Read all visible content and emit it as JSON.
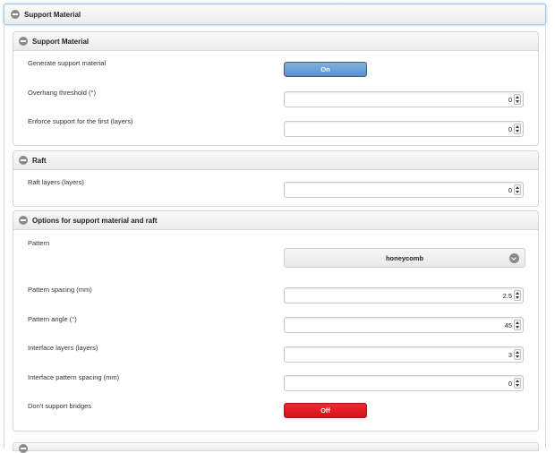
{
  "outer": {
    "title": "Support Material"
  },
  "support_panel": {
    "title": "Support Material",
    "generate": {
      "label": "Generate support material",
      "state": "On"
    },
    "overhang": {
      "label": "Overhang threshold (°)",
      "value": "0"
    },
    "enforce": {
      "label": "Enforce support for the first (layers)",
      "value": "0"
    }
  },
  "raft_panel": {
    "title": "Raft",
    "raft_layers": {
      "label": "Raft layers (layers)",
      "value": "0"
    }
  },
  "options_panel": {
    "title": "Options for support material and raft",
    "pattern": {
      "label": "Pattern",
      "selected": "honeycomb"
    },
    "pattern_spacing": {
      "label": "Pattern spacing (mm)",
      "value": "2.5"
    },
    "pattern_angle": {
      "label": "Pattern angle (°)",
      "value": "45"
    },
    "interface_layers": {
      "label": "Interface layers (layers)",
      "value": "3"
    },
    "interface_spacing": {
      "label": "Interface pattern spacing (mm)",
      "value": "0"
    },
    "dont_support_bridges": {
      "label": "Don't support bridges",
      "state": "Off"
    }
  },
  "colors": {
    "toggle_on": "#6aa0d8",
    "toggle_off": "#e41c24",
    "focus_border": "#9cc9e8"
  }
}
